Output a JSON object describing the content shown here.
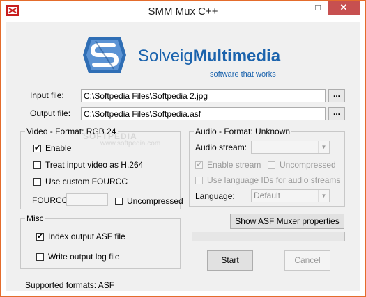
{
  "window": {
    "title": "SMM Mux C++",
    "minimize_glyph": "–",
    "maximize_glyph": "□",
    "close_glyph": "✕"
  },
  "logo": {
    "brand_regular": "Solveig",
    "brand_bold": "Multimedia",
    "tagline": "software that works",
    "brand_color": "#1b63ad"
  },
  "files": {
    "input_label": "Input file:",
    "input_value": "C:\\Softpedia Files\\Softpedia 2.jpg",
    "output_label": "Output file:",
    "output_value": "C:\\Softpedia Files\\Softpedia.asf",
    "browse_label": "..."
  },
  "video": {
    "group_title": "Video - Format: RGB 24",
    "enable": {
      "label": "Enable",
      "checked": true
    },
    "treat_h264": {
      "label": "Treat input video as H.264",
      "checked": false
    },
    "custom_fourcc": {
      "label": "Use custom FOURCC",
      "checked": false
    },
    "fourcc_label": "FOURCC:",
    "fourcc_value": "",
    "uncompressed": {
      "label": "Uncompressed",
      "checked": false
    }
  },
  "audio": {
    "group_title": "Audio - Format: Unknown",
    "stream_label": "Audio stream:",
    "stream_value": "",
    "enable_stream": {
      "label": "Enable stream",
      "checked": true
    },
    "uncompressed": {
      "label": "Uncompressed",
      "checked": false
    },
    "lang_ids": {
      "label": "Use language IDs for audio streams",
      "checked": false
    },
    "language_label": "Language:",
    "language_value": "Default"
  },
  "misc": {
    "group_title": "Misc",
    "index_asf": {
      "label": "Index output ASF file",
      "checked": true
    },
    "write_log": {
      "label": "Write output log file",
      "checked": false
    }
  },
  "actions": {
    "asf_properties_label": "Show ASF Muxer properties",
    "start_label": "Start",
    "cancel_label": "Cancel",
    "progress": 0
  },
  "status": {
    "supported_formats": "Supported formats: ASF"
  },
  "watermark": {
    "brand": "SOFTPEDIA",
    "url": "www.softpedia.com"
  },
  "icons": {
    "app": "smm-app-icon",
    "logo": "solveig-s-logo-icon",
    "checkmark": "checkmark-icon",
    "dropdown": "chevron-down-icon"
  }
}
